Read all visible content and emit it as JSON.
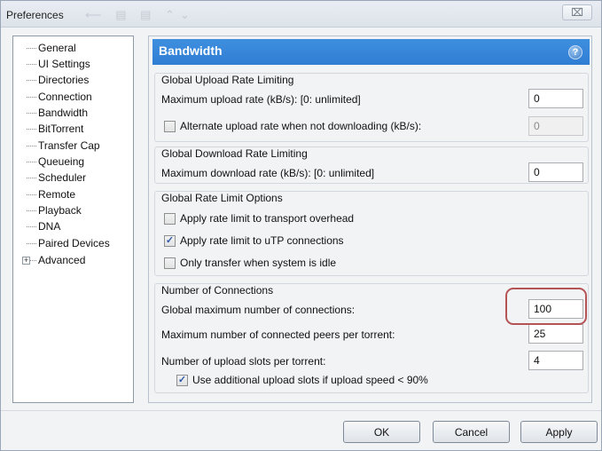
{
  "window": {
    "title": "Preferences",
    "close_glyph": "⌧"
  },
  "icons": {
    "close": "close-icon",
    "help": "help-icon",
    "checkmark": "checkmark-icon",
    "tree_expand": "plus-expand-icon"
  },
  "nav": {
    "items": [
      {
        "label": "General"
      },
      {
        "label": "UI Settings"
      },
      {
        "label": "Directories"
      },
      {
        "label": "Connection"
      },
      {
        "label": "Bandwidth"
      },
      {
        "label": "BitTorrent"
      },
      {
        "label": "Transfer Cap"
      },
      {
        "label": "Queueing"
      },
      {
        "label": "Scheduler"
      },
      {
        "label": "Remote"
      },
      {
        "label": "Playback"
      },
      {
        "label": "DNA"
      },
      {
        "label": "Paired Devices"
      },
      {
        "label": "Advanced",
        "expandable": true
      }
    ],
    "selected": "Bandwidth",
    "expander_glyph": "+"
  },
  "panel": {
    "title": "Bandwidth",
    "help_glyph": "?",
    "accent_color": "#3584da",
    "upload": {
      "title": "Global Upload Rate Limiting",
      "max_label": "Maximum upload rate (kB/s): [0: unlimited]",
      "max_value": "0",
      "alt_label": "Alternate upload rate when not downloading (kB/s):",
      "alt_checked": false,
      "alt_value": "0"
    },
    "download": {
      "title": "Global Download Rate Limiting",
      "max_label": "Maximum download rate (kB/s): [0: unlimited]",
      "max_value": "0"
    },
    "options": {
      "title": "Global Rate Limit Options",
      "transport_label": "Apply rate limit to transport overhead",
      "transport_checked": false,
      "utp_label": "Apply rate limit to uTP connections",
      "utp_checked": true,
      "idle_label": "Only transfer when system is idle",
      "idle_checked": false
    },
    "connections": {
      "title": "Number of Connections",
      "global_label": "Global maximum number of connections:",
      "global_value": "100",
      "peers_label": "Maximum number of connected peers per torrent:",
      "peers_value": "25",
      "slots_label": "Number of upload slots per torrent:",
      "slots_value": "4",
      "extra_label": "Use additional upload slots if upload speed < 90%",
      "extra_checked": true,
      "highlight_color": "#b55454"
    }
  },
  "buttons": {
    "ok": "OK",
    "cancel": "Cancel",
    "apply": "Apply"
  },
  "checkmark_glyph": "✓"
}
